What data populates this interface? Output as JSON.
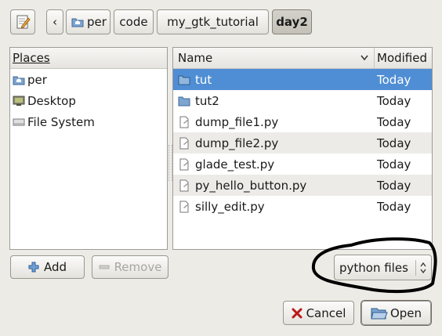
{
  "toolbar": {
    "breadcrumb": [
      "per",
      "code",
      "my_gtk_tutorial",
      "day2"
    ]
  },
  "places": {
    "header": "Places",
    "items": [
      {
        "label": "per",
        "icon": "home-folder-icon"
      },
      {
        "label": "Desktop",
        "icon": "desktop-icon"
      },
      {
        "label": "File System",
        "icon": "drive-icon"
      }
    ],
    "add_label": "Add",
    "remove_label": "Remove"
  },
  "files": {
    "col_name": "Name",
    "col_modified": "Modified",
    "rows": [
      {
        "name": "tut",
        "modified": "Today",
        "type": "folder"
      },
      {
        "name": "tut2",
        "modified": "Today",
        "type": "folder"
      },
      {
        "name": "dump_file1.py",
        "modified": "Today",
        "type": "file"
      },
      {
        "name": "dump_file2.py",
        "modified": "Today",
        "type": "file"
      },
      {
        "name": "glade_test.py",
        "modified": "Today",
        "type": "file"
      },
      {
        "name": "py_hello_button.py",
        "modified": "Today",
        "type": "file"
      },
      {
        "name": "silly_edit.py",
        "modified": "Today",
        "type": "file"
      }
    ]
  },
  "filter": {
    "selected": "python files"
  },
  "actions": {
    "cancel_label": "Cancel",
    "open_label": "Open"
  },
  "colors": {
    "selection": "#4f8ed4",
    "annotation": "#000000"
  }
}
